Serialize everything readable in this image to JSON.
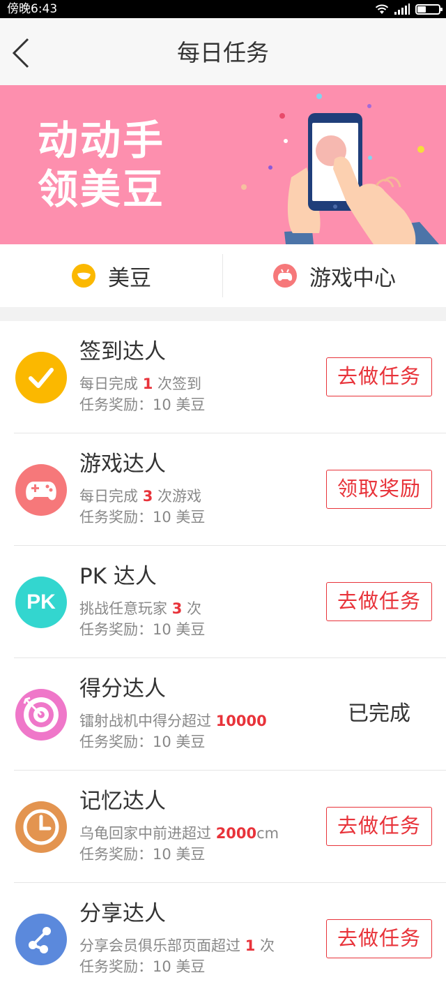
{
  "status_bar": {
    "time": "傍晚6:43",
    "icons": [
      "wifi-icon",
      "signal-icon",
      "battery-icon"
    ],
    "battery_level": 0.4
  },
  "nav": {
    "title": "每日任务",
    "back_icon": "chevron-left-icon"
  },
  "banner": {
    "line1": "动动手",
    "line2": "领美豆",
    "background": "#fd8fae"
  },
  "tabs": [
    {
      "label": "美豆",
      "icon": "bean-icon",
      "color": "#fbb800"
    },
    {
      "label": "游戏中心",
      "icon": "gamepad-icon",
      "color": "#f6787a"
    }
  ],
  "tasks": [
    {
      "title": "签到达人",
      "desc_prefix": "每日完成 ",
      "desc_highlight": "1",
      "desc_suffix": " 次签到",
      "reward": "任务奖励：10 美豆",
      "action": "去做任务",
      "done": false,
      "icon": "checkmark-icon",
      "icon_color": "#fbb800"
    },
    {
      "title": "游戏达人",
      "desc_prefix": "每日完成 ",
      "desc_highlight": "3",
      "desc_suffix": " 次游戏",
      "reward": "任务奖励：10 美豆",
      "action": "领取奖励",
      "done": false,
      "icon": "gamepad-icon",
      "icon_color": "#f6787a"
    },
    {
      "title": "PK 达人",
      "desc_prefix": "挑战任意玩家 ",
      "desc_highlight": "3",
      "desc_suffix": " 次",
      "reward": "任务奖励：10 美豆",
      "action": "去做任务",
      "done": false,
      "icon": "pk-icon",
      "icon_text": "PK",
      "icon_color": "#33d6cf"
    },
    {
      "title": "得分达人",
      "desc_prefix": "镭射战机中得分超过 ",
      "desc_highlight": "10000",
      "desc_suffix": "",
      "reward": "任务奖励：10 美豆",
      "action": "已完成",
      "done": true,
      "icon": "target-icon",
      "icon_color": "#ef77c9"
    },
    {
      "title": "记忆达人",
      "desc_prefix": "乌龟回家中前进超过 ",
      "desc_highlight": "2000",
      "desc_suffix": "cm",
      "reward": "任务奖励：10 美豆",
      "action": "去做任务",
      "done": false,
      "icon": "clock-icon",
      "icon_color": "#e39450"
    },
    {
      "title": "分享达人",
      "desc_prefix": "分享会员俱乐部页面超过 ",
      "desc_highlight": "1",
      "desc_suffix": " 次",
      "reward": "任务奖励：10 美豆",
      "action": "去做任务",
      "done": false,
      "icon": "share-icon",
      "icon_color": "#5b89dc"
    }
  ]
}
